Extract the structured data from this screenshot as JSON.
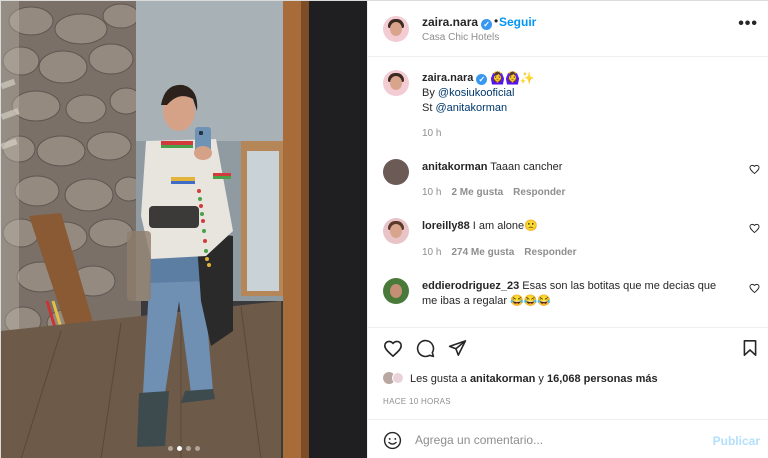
{
  "post": {
    "username": "zaira.nara",
    "follow_label": "Seguir",
    "location": "Casa Chic Hotels",
    "more_label": "•••",
    "separator": "•"
  },
  "caption": {
    "username": "zaira.nara",
    "emojis": "🙆‍♀️🙆‍♀️✨",
    "line1_prefix": "By ",
    "line1_mention": "@kosiukooficial",
    "line2_prefix": "St ",
    "line2_mention": "@anitakorman",
    "time": "10 h"
  },
  "comments": [
    {
      "username": "anitakorman",
      "text": "Taaan cancher",
      "time": "10 h",
      "likes": "2 Me gusta",
      "reply": "Responder",
      "avatar_color": "#6b5a55"
    },
    {
      "username": "loreilly88",
      "text": "I am alone🙁",
      "time": "10 h",
      "likes": "274 Me gusta",
      "reply": "Responder",
      "avatar_color": "#e8c3c8"
    },
    {
      "username": "eddierodriguez_23",
      "text": "Esas son las botitas que me decias que me ibas a regalar 😂😂😂",
      "time": "",
      "likes": "",
      "reply": "",
      "avatar_color": "#4a7a3a"
    }
  ],
  "likes_bar": {
    "prefix": "Les gusta a ",
    "user": "anitakorman",
    "middle": " y ",
    "count": "16,068 personas más"
  },
  "timestamp": "HACE 10 HORAS",
  "add_comment": {
    "placeholder": "Agrega un comentario...",
    "publish_label": "Publicar"
  },
  "icons": [
    "heart-icon",
    "comment-icon",
    "share-icon",
    "bookmark-icon",
    "emoji-icon",
    "verified-icon",
    "more-icon"
  ],
  "carousel": {
    "dots": 4,
    "active": 1
  },
  "colors": {
    "accent": "#0095f6",
    "verified": "#3897f0",
    "muted": "#8e8e8e",
    "publish_disabled": "#b2dffc"
  }
}
